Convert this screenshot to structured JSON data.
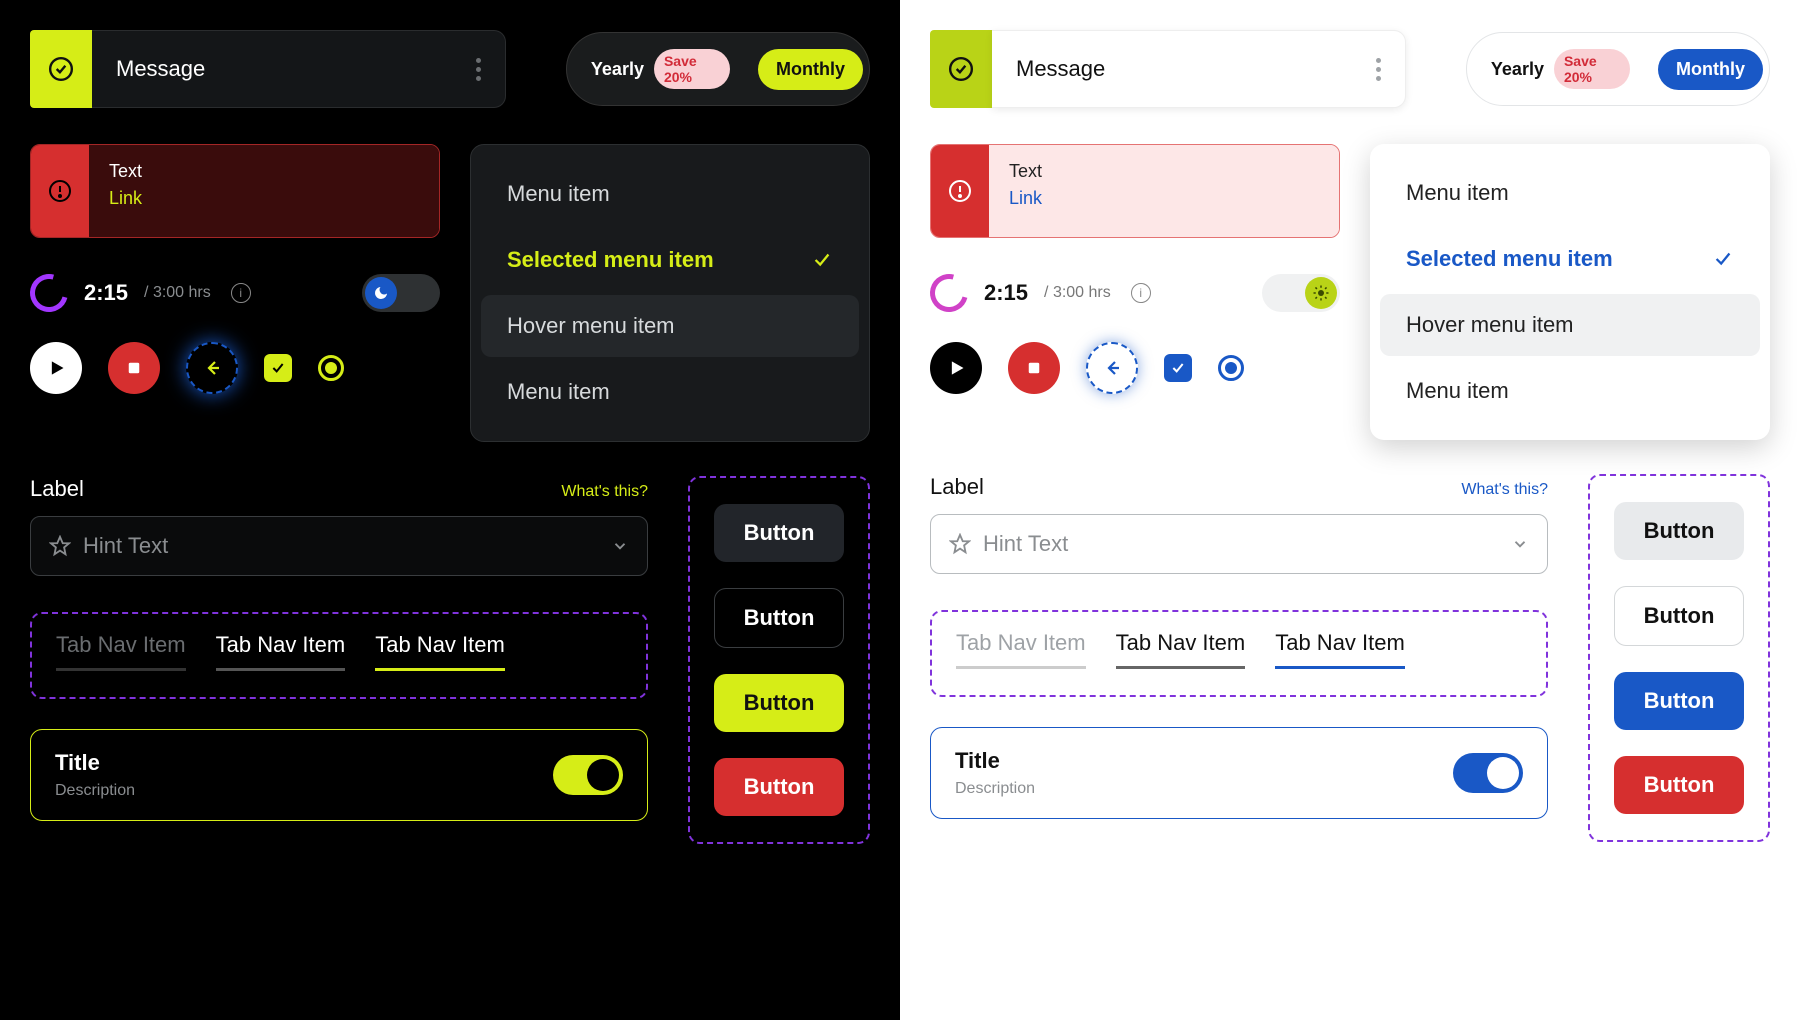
{
  "message_bar": {
    "label": "Message"
  },
  "billing": {
    "yearly_label": "Yearly",
    "save_badge": "Save 20%",
    "monthly_label": "Monthly"
  },
  "alert": {
    "text": "Text",
    "link": "Link"
  },
  "menu": {
    "items": [
      {
        "label": "Menu item",
        "state": "default"
      },
      {
        "label": "Selected menu item",
        "state": "selected"
      },
      {
        "label": "Hover menu item",
        "state": "hover"
      },
      {
        "label": "Menu item",
        "state": "default"
      }
    ]
  },
  "timer": {
    "elapsed": "2:15",
    "total": "/ 3:00 hrs"
  },
  "form": {
    "label": "Label",
    "hint_link": "What's this?",
    "placeholder": "Hint Text"
  },
  "tabs": {
    "items": [
      {
        "label": "Tab Nav Item",
        "state": "muted"
      },
      {
        "label": "Tab Nav Item",
        "state": "norm"
      },
      {
        "label": "Tab Nav Item",
        "state": "active"
      }
    ]
  },
  "card": {
    "title": "Title",
    "description": "Description"
  },
  "buttons": {
    "v1": "Button",
    "v2": "Button",
    "v3": "Button",
    "v4": "Button"
  },
  "colors": {
    "lime": "#D6ED17",
    "blue": "#1958C6",
    "red": "#D62F2F",
    "purple_dash": "#8033dc"
  }
}
